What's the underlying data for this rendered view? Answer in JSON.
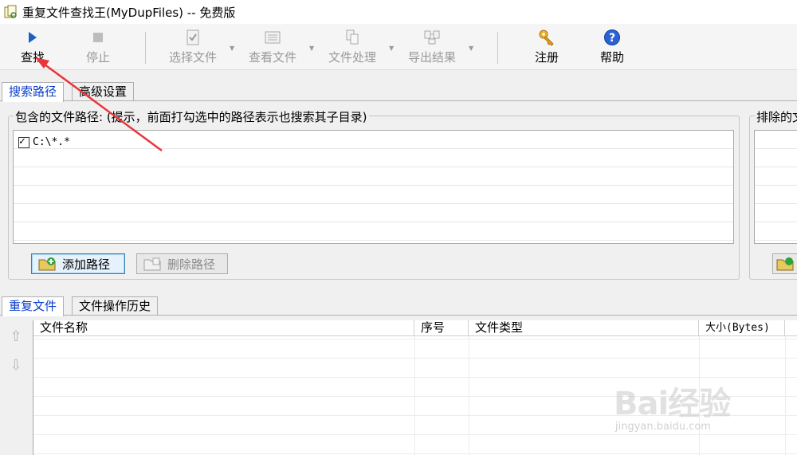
{
  "window": {
    "title": "重复文件查找王(MyDupFiles) -- 免费版"
  },
  "toolbar": {
    "find": "查找",
    "stop": "停止",
    "select_files": "选择文件",
    "view_files": "查看文件",
    "file_processing": "文件处理",
    "export_results": "导出结果",
    "register": "注册",
    "help": "帮助"
  },
  "top_tabs": [
    "搜索路径",
    "高级设置"
  ],
  "include_group": {
    "title": "包含的文件路径: (提示，前面打勾选中的路径表示也搜索其子目录)",
    "paths": [
      {
        "path": "C:\\*.*",
        "checked": true
      }
    ],
    "add_button": "添加路径",
    "delete_button": "删除路径"
  },
  "exclude_group": {
    "title": "排除的文"
  },
  "bottom_tabs": [
    "重复文件",
    "文件操作历史"
  ],
  "table": {
    "columns": [
      "文件名称",
      "序号",
      "文件类型",
      "大小(Bytes)"
    ]
  },
  "watermark": {
    "main": "Bai经验",
    "sub": "jingyan.baidu.com"
  },
  "colors": {
    "active_tab": "#0a3ccf",
    "annotation_arrow": "#e8353a",
    "play_icon": "#1d5fbf"
  }
}
